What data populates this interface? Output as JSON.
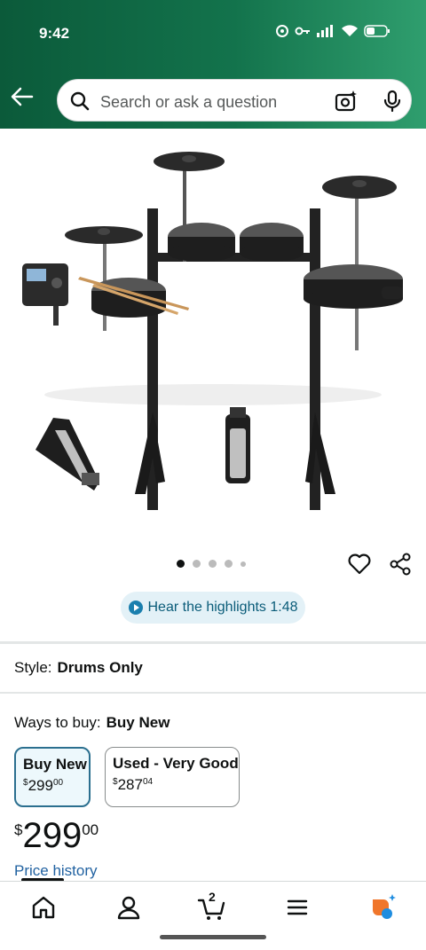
{
  "status_bar": {
    "time": "9:42"
  },
  "search": {
    "placeholder": "Search or ask a question"
  },
  "gallery": {
    "dot_count": 5,
    "active_index": 0
  },
  "highlights": {
    "label": "Hear the highlights 1:48"
  },
  "style": {
    "label": "Style:",
    "value": "Drums Only"
  },
  "ways_to_buy": {
    "label": "Ways to buy:",
    "value": "Buy New",
    "options": [
      {
        "title": "Buy New",
        "currency": "$",
        "whole": "299",
        "fraction": "00",
        "selected": true
      },
      {
        "title": "Used - Very Good",
        "currency": "$",
        "whole": "287",
        "fraction": "04",
        "selected": false
      }
    ]
  },
  "price": {
    "currency": "$",
    "whole": "299",
    "fraction": "00"
  },
  "price_history": {
    "label": "Price history"
  },
  "bottom_nav": {
    "cart_count": "2"
  },
  "colors": {
    "header_dark": "#0b5a3a",
    "header_light": "#2f9e6e",
    "link": "#2162a1",
    "selected_border": "#2b6f8f"
  },
  "icons": [
    "back-arrow-icon",
    "search-icon",
    "camera-icon",
    "mic-icon",
    "heart-icon",
    "share-icon",
    "home-icon",
    "account-icon",
    "cart-icon",
    "menu-icon",
    "rufus-icon"
  ]
}
